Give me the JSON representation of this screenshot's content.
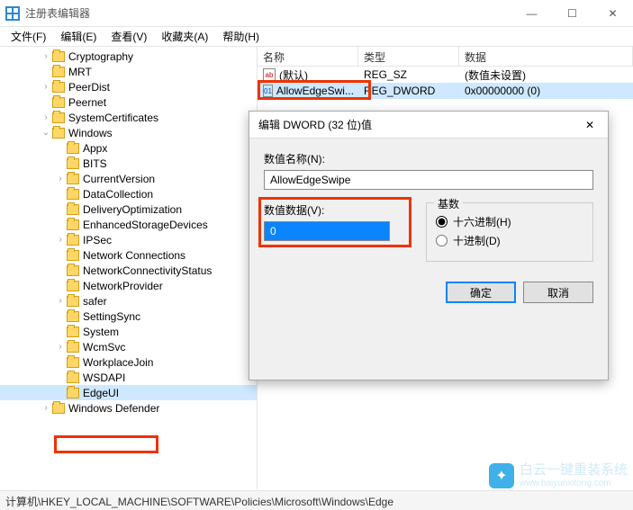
{
  "window": {
    "title": "注册表编辑器",
    "min": "—",
    "max": "☐",
    "close": "✕"
  },
  "menu": {
    "file": "文件(F)",
    "edit": "编辑(E)",
    "view": "查看(V)",
    "favorites": "收藏夹(A)",
    "help": "帮助(H)"
  },
  "columns": {
    "name": "名称",
    "type": "类型",
    "data": "数据"
  },
  "values": {
    "row0": {
      "name": "(默认)",
      "type": "REG_SZ",
      "data": "(数值未设置)"
    },
    "row1": {
      "name": "AllowEdgeSwi...",
      "type": "REG_DWORD",
      "data": "0x00000000 (0)"
    }
  },
  "tree": {
    "n0": "Cryptography",
    "n1": "MRT",
    "n2": "PeerDist",
    "n3": "Peernet",
    "n4": "SystemCertificates",
    "n5": "Windows",
    "c0": "Appx",
    "c1": "BITS",
    "c2": "CurrentVersion",
    "c3": "DataCollection",
    "c4": "DeliveryOptimization",
    "c5": "EnhancedStorageDevices",
    "c6": "IPSec",
    "c7": "Network Connections",
    "c8": "NetworkConnectivityStatus",
    "c9": "NetworkProvider",
    "c10": "safer",
    "c11": "SettingSync",
    "c12": "System",
    "c13": "WcmSvc",
    "c14": "WorkplaceJoin",
    "c15": "WSDAPI",
    "c16": "EdgeUI",
    "n6": "Windows Defender"
  },
  "dialog": {
    "title": "编辑 DWORD (32 位)值",
    "nameLabel": "数值名称(N):",
    "nameValue": "AllowEdgeSwipe",
    "dataLabel": "数值数据(V):",
    "dataValue": "0",
    "baseLabel": "基数",
    "hex": "十六进制(H)",
    "dec": "十进制(D)",
    "ok": "确定",
    "cancel": "取消"
  },
  "statusbar": "计算机\\HKEY_LOCAL_MACHINE\\SOFTWARE\\Policies\\Microsoft\\Windows\\Edge",
  "watermark": {
    "text1": "白云一键重装系统",
    "text2": "www.baiyunxitong.com"
  }
}
